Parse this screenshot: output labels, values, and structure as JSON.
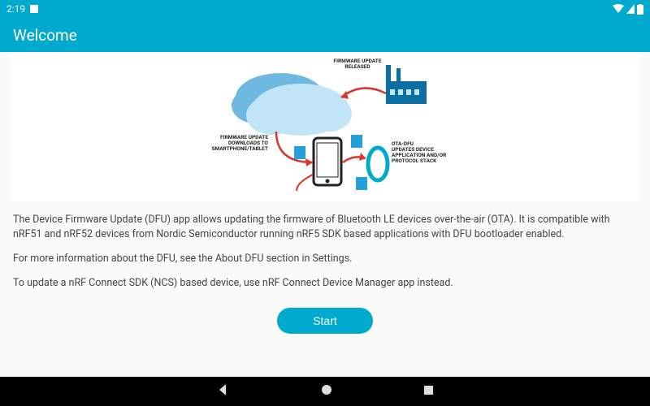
{
  "status": {
    "time": "2:19",
    "wifi": "wifi",
    "signal": "signal",
    "battery": "battery"
  },
  "appbar": {
    "title": "Welcome"
  },
  "diagram": {
    "label_released": "FIRMWARE UPDATE\nRELEASED",
    "label_download": "FIRMWARE UPDATE\nDOWNLOADS TO\nSMARTPHONE/TABLET",
    "label_ota": "OTA-DFU\nUPDATES DEVICE\nAPPLICATION AND/OR\nPROTOCOL STACK"
  },
  "body": {
    "p1": "The Device Firmware Update (DFU) app allows updating the firmware of Bluetooth LE devices over-the-air (OTA). It is compatible with nRF51 and nRF52 devices from Nordic Semiconductor running nRF5 SDK based applications with DFU bootloader enabled.",
    "p2": "For more information about the DFU, see the About DFU section in Settings.",
    "p3": "To update a nRF Connect SDK (NCS) based device, use nRF Connect Device Manager app instead."
  },
  "actions": {
    "start": "Start"
  }
}
